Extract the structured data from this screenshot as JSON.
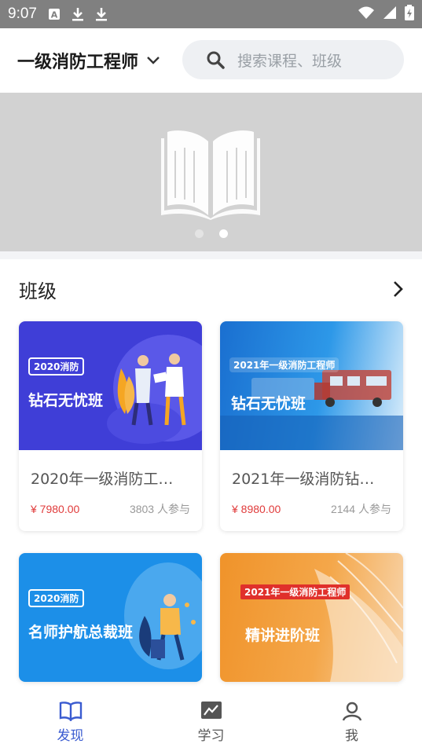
{
  "status_bar": {
    "time": "9:07"
  },
  "header": {
    "exam_name": "一级消防工程师",
    "search_placeholder": "搜索课程、班级"
  },
  "banner": {
    "slides": 2,
    "active_slide": 2
  },
  "section": {
    "title": "班级"
  },
  "courses": [
    {
      "name": "2020年一级消防工…",
      "price": "¥ 7980.00",
      "participants": "3803 人参与",
      "badge": "2020消防",
      "headline": "钻石无忧班",
      "thumb_color": "#3f3ed7"
    },
    {
      "name": "2021年一级消防钻…",
      "price": "¥ 8980.00",
      "participants": "2144 人参与",
      "badge": "2021年一级消防工程师",
      "headline": "钻石无忧班",
      "thumb_color": "#1e7fd6"
    },
    {
      "name": "",
      "price": "",
      "participants": "",
      "badge": "2020消防",
      "headline": "名师护航总裁班",
      "thumb_color": "#1c8fe8"
    },
    {
      "name": "",
      "price": "",
      "participants": "",
      "badge": "2021年一级消防工程师",
      "headline": "精讲进阶班",
      "thumb_color": "#f0932a"
    }
  ],
  "tabs": [
    {
      "label": "发现",
      "icon": "book-icon",
      "active": true
    },
    {
      "label": "学习",
      "icon": "chart-icon",
      "active": false
    },
    {
      "label": "我",
      "icon": "user-icon",
      "active": false
    }
  ]
}
